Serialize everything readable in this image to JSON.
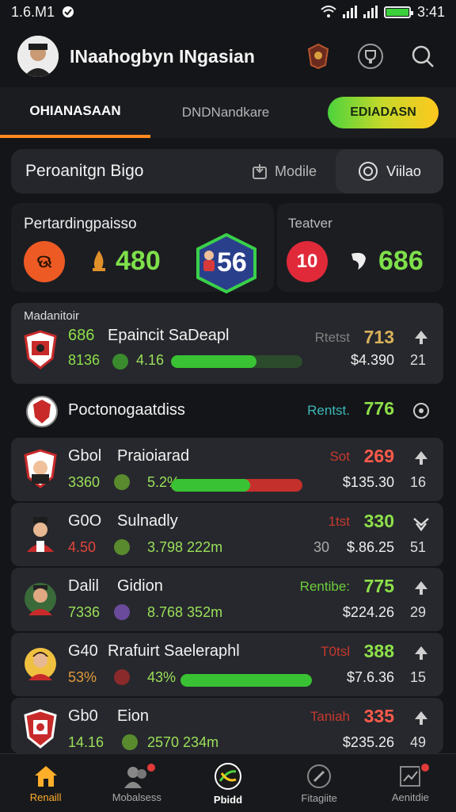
{
  "statusbar": {
    "left": "1.6.M1",
    "time": "3:41"
  },
  "header": {
    "title": "INaahogbyn INgasian"
  },
  "tabs": {
    "tab1": "OHIANASAAN",
    "tab2": "DNDNandkare",
    "cta": "EDIADASN"
  },
  "filter": {
    "title": "Peroanitgn Bigo",
    "mode": "Modile",
    "video": "Viilao"
  },
  "stats": {
    "label_a": "Pertardingpaisso",
    "ball_a_text": "ଊ",
    "value_a": "480",
    "hex_value": "56",
    "label_b": "Teatver",
    "ball_b_text": "10",
    "value_b": "686"
  },
  "section_label": "Madanitoir",
  "rows": [
    {
      "rank": "686",
      "name": "Epaincit SaDeapl",
      "sub": "8136",
      "subval": "4.16",
      "tag": "Rtetst",
      "score": "713",
      "price": "$4.390",
      "count": "21",
      "bar": 0.65,
      "bar_red": 0,
      "tag_color": "#7f7f7f",
      "score_color": "#d9b25a",
      "sub_color": "#9be05a"
    },
    {
      "rank": "",
      "name": "Poctonogaatdiss",
      "sub": "",
      "subval": "",
      "tag": "Rentst.",
      "score": "776",
      "price": "",
      "count": "",
      "bar": 0,
      "bar_red": 0,
      "tag_color": "#3cb7b7",
      "score_color": "#8ee04a",
      "sub_color": "#9be05a"
    },
    {
      "rank": "Gbol",
      "name": "Praioiarad",
      "sub": "3360",
      "subval": "5.2%",
      "tag": "Sot",
      "score": "269",
      "price": "$135.30",
      "count": "16",
      "bar": 0.6,
      "bar_red": 0.4,
      "tag_color": "#c8392e",
      "score_color": "#ff5a4a",
      "sub_color": "#9be05a"
    },
    {
      "rank": "G0O",
      "name": "Sulnadly",
      "sub": "4.50",
      "subval": "3.798 222m",
      "tag": "1tst",
      "score": "330",
      "price": "$.86.25",
      "count": "51",
      "bar": 0,
      "bar_red": 0,
      "tag_color": "#c8392e",
      "score_color": "#8ee04a",
      "sub_color": "#e2453a",
      "pre_price": "30"
    },
    {
      "rank": "Dalil",
      "name": "Gidion",
      "sub": "7336",
      "subval": "8.768 352m",
      "tag": "Rentibe:",
      "score": "775",
      "price": "$224.26",
      "count": "29",
      "bar": 0,
      "bar_red": 0,
      "tag_color": "#6ccd3c",
      "score_color": "#8ee04a",
      "sub_color": "#9be05a"
    },
    {
      "rank": "G40",
      "name": "Rrafuirt Saeleraphl",
      "sub": "53%",
      "subval": "43%",
      "tag": "T0tsl",
      "score": "388",
      "price": "$7.6.36",
      "count": "15",
      "bar": 1.0,
      "bar_red": 0,
      "tag_color": "#c8392e",
      "score_color": "#8ee04a",
      "sub_color": "#e09a3a"
    },
    {
      "rank": "Gb0",
      "name": "Eion",
      "sub": "14.16",
      "subval": "2570 234m",
      "tag": "Taniah",
      "score": "335",
      "price": "$235.26",
      "count": "49",
      "bar": 0,
      "bar_red": 0,
      "tag_color": "#c8392e",
      "score_color": "#ff5a4a",
      "sub_color": "#9be05a"
    }
  ],
  "nav": [
    {
      "label": "Renaill",
      "icon": "home-icon"
    },
    {
      "label": "Mobalsess",
      "icon": "players-icon"
    },
    {
      "label": "Pbidd",
      "icon": "ball-icon"
    },
    {
      "label": "Fitagiite",
      "icon": "edit-icon"
    },
    {
      "label": "Aenitdie",
      "icon": "chart-icon"
    }
  ]
}
